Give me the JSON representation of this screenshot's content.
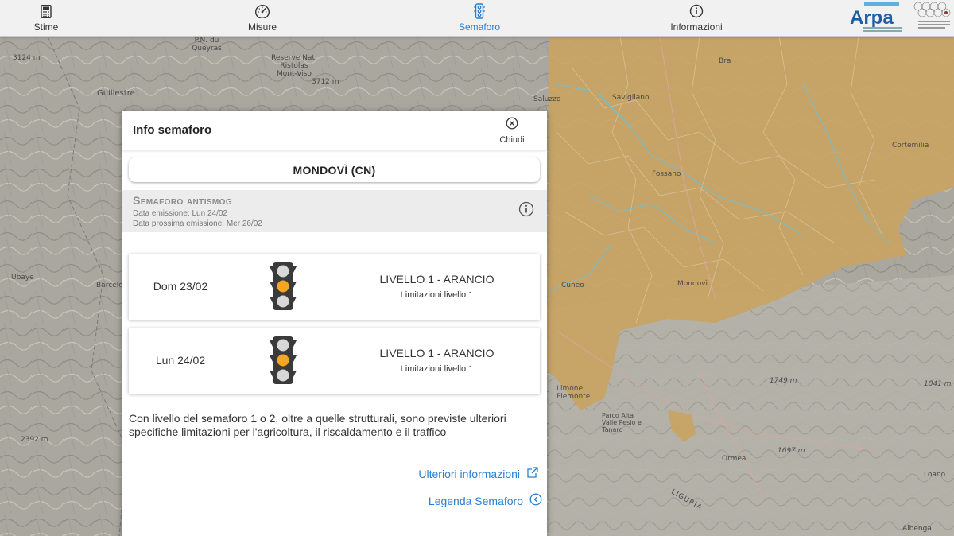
{
  "nav": {
    "items": [
      {
        "label": "Stime",
        "icon": "calculator-icon"
      },
      {
        "label": "Misure",
        "icon": "gauge-icon"
      },
      {
        "label": "Semaforo",
        "icon": "traffic-light-icon"
      },
      {
        "label": "Informazioni",
        "icon": "info-icon"
      }
    ],
    "active": "Semaforo",
    "accent_color": "#1e7fd8",
    "brand": {
      "name": "Arpa"
    }
  },
  "map": {
    "labels": [
      "3124 m",
      "Guillestre",
      "P.N. du Queyras",
      "Reserve Nat. Ristolas Mont-Viso",
      "3712 m",
      "Bra",
      "Saluzzo",
      "Savigliano",
      "Fossano",
      "Cuneo",
      "Mondovì",
      "Barcelo",
      "Ubaye",
      "2392 m",
      "Limone Piemonte",
      "Parco Alta Valle Pesio e Tanaro",
      "Ormea",
      "1749 m",
      "1697 m",
      "1041 m",
      "Loano",
      "Albenga",
      "LIGURIA",
      "Cortemilia"
    ],
    "highlight_color": "#c9a464"
  },
  "modal": {
    "title": "Info semaforo",
    "close_label": "Chiudi",
    "station": "MONDOVÌ (CN)",
    "band": {
      "title": "Semaforo antismog",
      "emission": "Data emissione: Lun 24/02",
      "next_emission": "Data prossima emissione: Mer 26/02"
    },
    "days": [
      {
        "day": "Dom 23/02",
        "level": "LIVELLO 1 - ARANCIO",
        "sub": "Limitazioni livello 1",
        "active_light": "orange"
      },
      {
        "day": "Lun 24/02",
        "level": "LIVELLO 1 - ARANCIO",
        "sub": "Limitazioni livello 1",
        "active_light": "orange"
      }
    ],
    "note": "Con livello del semaforo 1 o 2, oltre a quelle strutturali, sono previste ulteriori specifiche limitazioni per l'agricoltura, il riscaldamento e il traffico",
    "links": {
      "more_info": "Ulteriori informazioni",
      "legend": "Legenda Semaforo"
    },
    "light_on_color": "#f5a623",
    "light_off_color": "#d8d8d8"
  }
}
